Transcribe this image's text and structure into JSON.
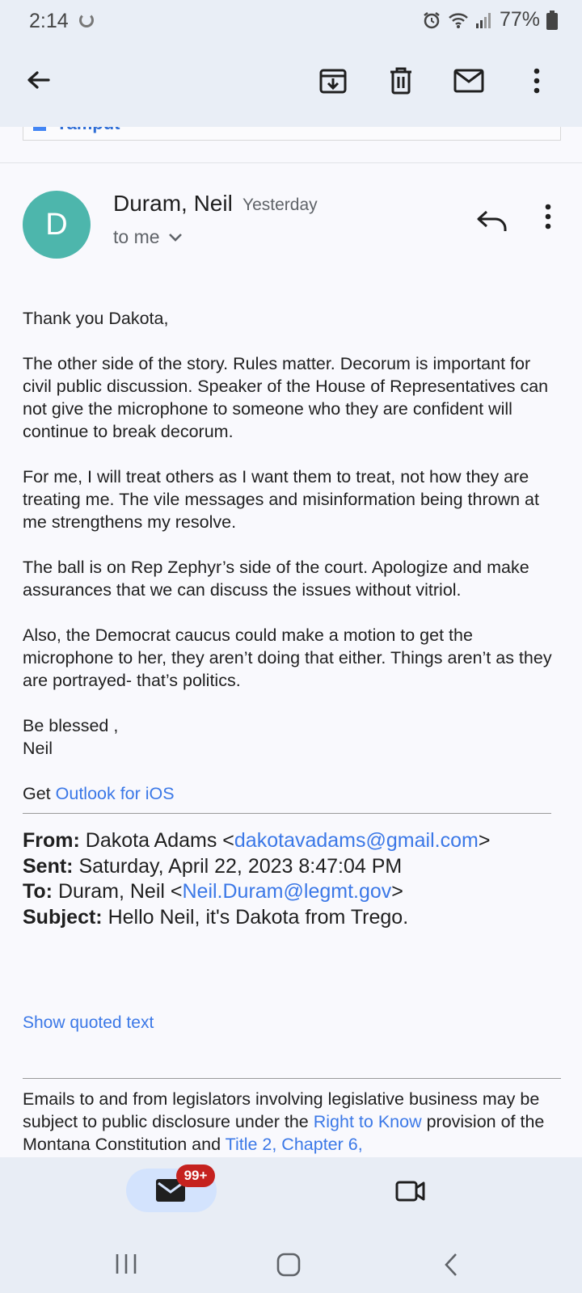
{
  "status_bar": {
    "time": "2:14",
    "battery": "77%"
  },
  "toolbar": {
    "icons": [
      "back-arrow-icon",
      "archive-icon",
      "delete-icon",
      "mark-unread-icon",
      "more-vert-icon"
    ]
  },
  "remnant": {
    "text": "Yamput"
  },
  "message": {
    "avatar_letter": "D",
    "avatar_color": "#4db6ac",
    "sender": "Duram, Neil",
    "date": "Yesterday",
    "to": "to me",
    "greeting": "Thank you Dakota,",
    "p1": "The other side of the story.  Rules matter.  Decorum is important for civil public discussion.  Speaker of the House of Representatives can not give the microphone to someone who they are confident will continue to break decorum.",
    "p2": "For me, I will treat others as I want them to treat, not how they are treating me.  The vile messages and misinformation being thrown at me strengthens my resolve.",
    "p3": "The ball is on Rep Zephyr’s side of the court.  Apologize and make assurances that we can discuss the issues without vitriol.",
    "p4": "Also, the Democrat caucus could make a motion to get the microphone to her, they aren’t doing that either. Things aren’t as they are portrayed- that’s politics.",
    "closing": "Be blessed ,",
    "signature": "Neil",
    "get_prefix": "Get ",
    "get_link": "Outlook for iOS"
  },
  "quoted": {
    "from_label": "From:",
    "from_name": " Dakota Adams <",
    "from_email": "dakotavadams@gmail.com",
    "from_close": ">",
    "sent_label": "Sent:",
    "sent_value": " Saturday, April 22, 2023 8:47:04 PM",
    "to_label": "To:",
    "to_name": " Duram, Neil <",
    "to_email": "Neil.Duram@legmt.gov",
    "to_close": ">",
    "subject_label": "Subject:",
    "subject_value": " Hello Neil, it's Dakota from Trego.",
    "show_quoted": "Show quoted text"
  },
  "disclaimer": {
    "t1": "Emails to and from legislators involving legislative business may be subject to public disclosure under the ",
    "link1": "Right to Know",
    "t2": " provision of the Montana Constitution and ",
    "link2": "Title 2, Chapter 6,"
  },
  "bottom_nav": {
    "badge": "99+"
  },
  "colors": {
    "link": "#3b78e7",
    "badge": "#c5221f",
    "nav_bg": "#e8edf5",
    "active_tab": "#d3e3fd"
  }
}
